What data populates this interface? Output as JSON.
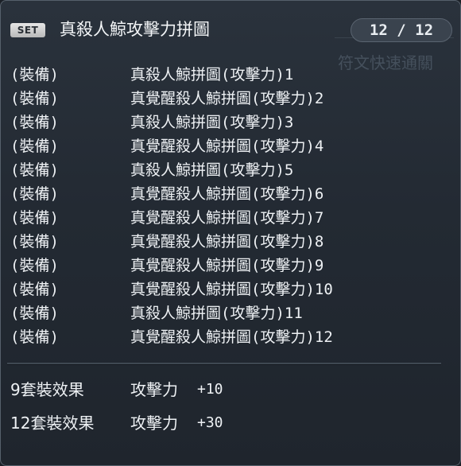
{
  "header": {
    "badge": "SET",
    "title": "真殺人鯨攻擊力拼圖",
    "counter": "12 / 12",
    "background_text": "符文快速通關"
  },
  "items": [
    {
      "tag": "(裝備)",
      "name": "真殺人鯨拼圖(攻擊力)1"
    },
    {
      "tag": "(裝備)",
      "name": "真覺醒殺人鯨拼圖(攻擊力)2"
    },
    {
      "tag": "(裝備)",
      "name": "真殺人鯨拼圖(攻擊力)3"
    },
    {
      "tag": "(裝備)",
      "name": "真覺醒殺人鯨拼圖(攻擊力)4"
    },
    {
      "tag": "(裝備)",
      "name": "真殺人鯨拼圖(攻擊力)5"
    },
    {
      "tag": "(裝備)",
      "name": "真覺醒殺人鯨拼圖(攻擊力)6"
    },
    {
      "tag": "(裝備)",
      "name": "真覺醒殺人鯨拼圖(攻擊力)7"
    },
    {
      "tag": "(裝備)",
      "name": "真覺醒殺人鯨拼圖(攻擊力)8"
    },
    {
      "tag": "(裝備)",
      "name": "真覺醒殺人鯨拼圖(攻擊力)9"
    },
    {
      "tag": "(裝備)",
      "name": "真覺醒殺人鯨拼圖(攻擊力)10"
    },
    {
      "tag": "(裝備)",
      "name": "真殺人鯨拼圖(攻擊力)11"
    },
    {
      "tag": "(裝備)",
      "name": "真覺醒殺人鯨拼圖(攻擊力)12"
    }
  ],
  "bonuses": [
    {
      "label": "9套裝效果",
      "stat": "攻擊力",
      "value": "+10"
    },
    {
      "label": "12套裝效果",
      "stat": "攻擊力",
      "value": "+30"
    }
  ]
}
